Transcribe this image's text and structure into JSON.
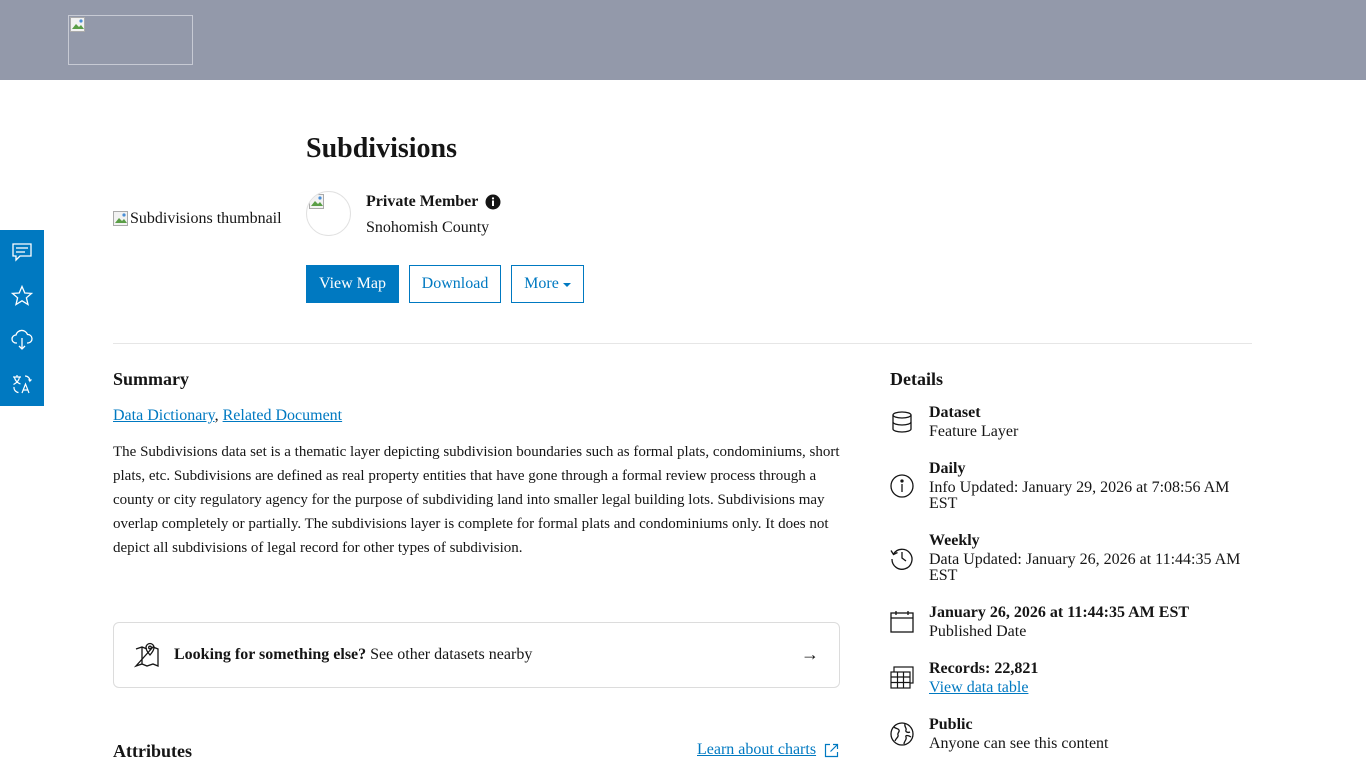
{
  "header": {
    "logo_alt": ""
  },
  "sidebar": {
    "items": [
      {
        "name": "comment-icon"
      },
      {
        "name": "star-icon"
      },
      {
        "name": "cloud-download-icon"
      },
      {
        "name": "translate-icon"
      }
    ]
  },
  "item": {
    "thumbnail_alt": "Subdivisions thumbnail",
    "title": "Subdivisions",
    "owner_name": "Private Member",
    "owner_org": "Snohomish County"
  },
  "actions": {
    "view_map": "View Map",
    "download": "Download",
    "more": "More"
  },
  "summary": {
    "heading": "Summary",
    "link1": "Data Dictionary",
    "separator": ", ",
    "link2": "Related Document",
    "description": "The Subdivisions data set is a thematic layer depicting subdivision boundaries such as formal plats, condominiums, short plats, etc. Subdivisions are defined as real property entities that have gone through a formal review process through a county or city regulatory agency for the purpose of subdividing land into smaller legal building lots. Subdivisions may overlap completely or partially. The subdivisions layer is complete for formal plats and condominiums only. It does not depict all subdivisions of legal record for other types of subdivision."
  },
  "nearby": {
    "bold": "Looking for something else?",
    "text": " See other datasets nearby",
    "arrow": "→"
  },
  "attributes": {
    "heading": "Attributes",
    "learn_link": "Learn about charts"
  },
  "details": {
    "heading": "Details",
    "rows": [
      {
        "icon": "database-icon",
        "title": "Dataset",
        "sub": "Feature Layer"
      },
      {
        "icon": "info-icon",
        "title": "Daily",
        "sub": "Info Updated: January 29, 2026 at 7:08:56 AM EST"
      },
      {
        "icon": "history-icon",
        "title": "Weekly",
        "sub": "Data Updated: January 26, 2026 at 11:44:35 AM EST"
      },
      {
        "icon": "calendar-icon",
        "title": "January 26, 2026 at 11:44:35 AM EST",
        "sub": "Published Date"
      },
      {
        "icon": "table-icon",
        "title": "Records: 22,821",
        "sub": "View data table"
      },
      {
        "icon": "globe-icon",
        "title": "Public",
        "sub": "Anyone can see this content"
      }
    ]
  }
}
